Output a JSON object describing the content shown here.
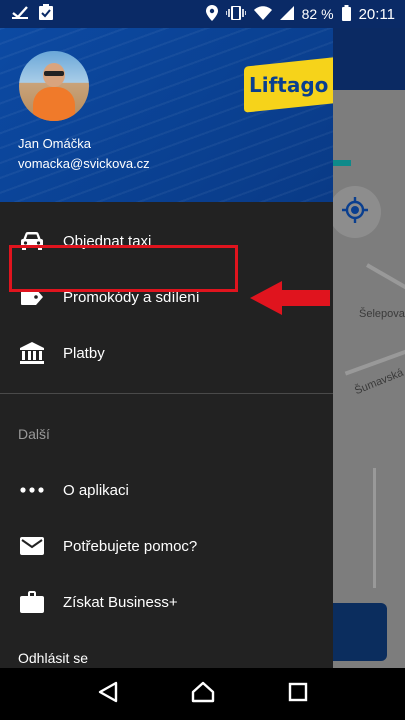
{
  "status_bar": {
    "battery_percent": "82 %",
    "time": "20:11"
  },
  "drawer": {
    "logo_text": "Liftago",
    "user_name": "Jan Omáčka",
    "user_email": "vomacka@svickova.cz",
    "items": [
      {
        "label": "Objednat taxi",
        "icon": "car-icon"
      },
      {
        "label": "Promokódy a sdílení",
        "icon": "tag-icon"
      },
      {
        "label": "Platby",
        "icon": "bank-icon"
      }
    ],
    "section_label": "Další",
    "more_items": [
      {
        "label": "O aplikaci",
        "icon": "more-dots-icon"
      },
      {
        "label": "Potřebujete pomoc?",
        "icon": "mail-icon"
      },
      {
        "label": "Získat Business+",
        "icon": "briefcase-icon"
      }
    ],
    "logout_label": "Odhlásit se"
  },
  "map": {
    "street_labels": [
      "Šelepova",
      "Šumavská"
    ]
  },
  "colors": {
    "header_blue": "#0a3f8f",
    "logo_yellow": "#f6d31a",
    "highlight_red": "#e0141e",
    "drawer_bg": "#222222"
  }
}
